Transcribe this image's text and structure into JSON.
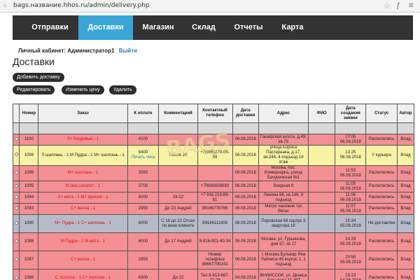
{
  "browser": {
    "url": "bags.название.hhos.ru/admin/delivery.php"
  },
  "nav": {
    "items": [
      "Отправки",
      "Доставки",
      "Магазин",
      "Склад",
      "Отчеты",
      "Карта"
    ],
    "active": "Доставки"
  },
  "cabinet": {
    "label": "Личный кабинет: Администратор1",
    "logout": "Выйти"
  },
  "page": {
    "title": "Доставки"
  },
  "buttons": {
    "add": "Добавить доставку",
    "edit": "Редактировать",
    "change_price": "Изменить цену",
    "delete": "Удалить"
  },
  "table": {
    "headers": [
      "",
      "Номер",
      "Заказ",
      "К оплате",
      "Комментарий",
      "Контактный телефон",
      "Дата доставки",
      "Адрес",
      "ФИО",
      "Дата создания заявки",
      "Статус",
      "Автор"
    ],
    "rows": [
      {
        "tone": "lgray",
        "tall": false,
        "cells": [
          "",
          "",
          "",
          "",
          "",
          "",
          "",
          "",
          "",
          "",
          "",
          ""
        ]
      },
      {
        "tone": "red",
        "tall": false,
        "cells": [
          "",
          "1100",
          "Л+ бордовый - 1",
          "4100",
          "",
          "",
          "06.08.2018",
          "Гаширская шоссе, д.49, кв.78",
          "",
          "17:05 06.08.2018",
          "Распилились",
          "Влад"
        ]
      },
      {
        "tone": "yellow",
        "tall": true,
        "cells": [
          "",
          "1099",
          "Л шалпань - 1 М Пудра - 1 М+ шалпань - 1",
          "8400",
          "После 20",
          "+7(985)279-05-59",
          "06.08.2018",
          "улица Бориса Пастернака, д.17, кв.244, 4 подъезд 14 этаж",
          "",
          "13:25 06.08.2018",
          "У курьера",
          "Влад"
        ],
        "print": "Печать чека"
      },
      {
        "tone": "red",
        "tall": false,
        "cells": [
          "",
          "1096",
          "М+ шалпань - 1",
          "3950",
          "",
          "",
          "06.08.2018",
          "Москва, пос. Коммунарка, улица Бачуринская 8к1",
          "",
          "11:53 06.08.2018",
          "Распилились",
          "Влад"
        ]
      },
      {
        "tone": "red",
        "tall": false,
        "cells": [
          "",
          "1095",
          "М они.сачолет - 1",
          "3700",
          "",
          "+79685658693",
          "06.08.2018",
          "Вокрная 8",
          "",
          "11:05 06.08.2018",
          "Распилились",
          "Влад"
        ]
      },
      {
        "tone": "red",
        "tall": false,
        "cells": [
          "",
          "1094",
          "Л+ мята - 1 М+ фуксия - 1",
          "6000",
          "19-22",
          "+7 916 219-89-61",
          "06.08.2018",
          "Ленина 68, кв.149, 9 подъезд",
          "",
          "11:06 06.08.2018",
          "Распилились",
          "Влад"
        ]
      },
      {
        "tone": "red",
        "tall": false,
        "cells": [
          "",
          "1093",
          "С+ волна - 1",
          "2950",
          "До 23 Андрей",
          "89166776766",
          "06.08.2018",
          "Метро насижно тус Вегас",
          "",
          "11:07 06.08.2018",
          "Распилились",
          "Влад"
        ]
      },
      {
        "tone": "gray",
        "tall": true,
        "cells": [
          "",
          "1090",
          "М+ Пудра - 1 С+ шалпань - 1",
          "6000",
          "С 18 до 22 Отсал по вине клиента",
          "89166111406",
          "06.08.2018",
          "Перовская 66 корпус 5 квартира 16",
          "",
          "15:34 05.08.2018",
          "Не доставлен",
          "Влад"
        ]
      },
      {
        "tone": "red",
        "tall": true,
        "cells": [
          "",
          "1088",
          "М Пудра - 1 М мята - 1",
          "6000",
          "До 17 Андрей",
          "8-916-901-40-34",
          "06.08.2018",
          "Москва, ул. Гурьянова, дом 67, кв 17",
          "",
          "14:29 05.08.2018",
          "Распилились",
          "Влад"
        ]
      },
      {
        "tone": "red",
        "tall": true,
        "cells": [
          "",
          "1087",
          "С+ волна - 1",
          "2950",
          "",
          "Номер телефона 89667795243",
          "06.08.2018",
          "г. Москва Бульвар Яна Райниса 45 корпус 1, 1 подъезд",
          "",
          "20:50 05.08.2018",
          "Распилились",
          "Влад"
        ]
      },
      {
        "tone": "red",
        "tall": true,
        "cells": [
          "",
          "1086",
          "С полоски - 1 С+ полоски - 1",
          "6300",
          "До 22",
          "Тел 8-913-697-22-28",
          "04.08.2018",
          "ВНИИССОК, ул. Дениса Давыдова 11-497",
          "",
          "15:23 04.08.2018",
          "Распилились",
          "Влад"
        ]
      }
    ]
  }
}
